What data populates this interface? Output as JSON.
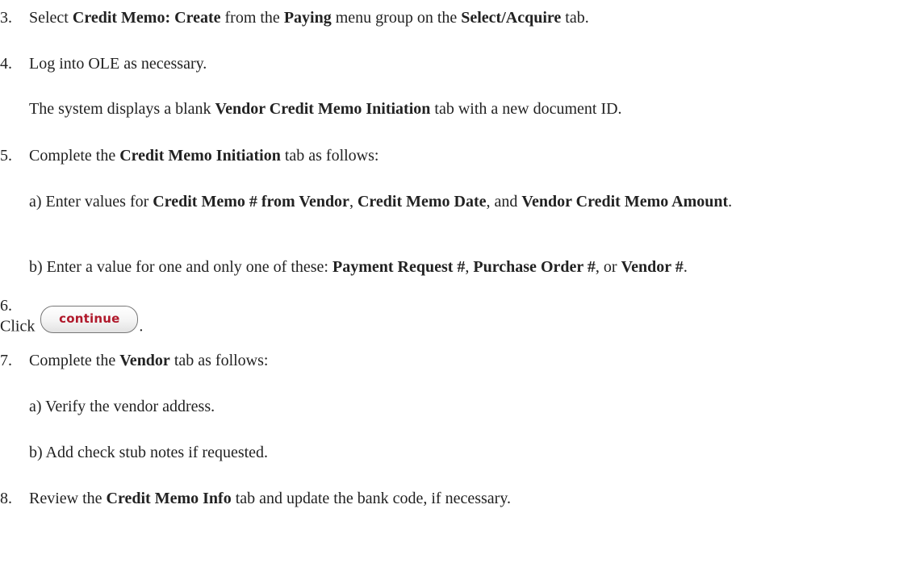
{
  "steps": [
    {
      "num": "3.",
      "parts": [
        "Select ",
        "Credit Memo: Create",
        " from the ",
        "Paying",
        " menu group on the ",
        "Select/Acquire",
        " tab."
      ]
    },
    {
      "num": "4.",
      "text": "Log into OLE as necessary.",
      "note_parts": [
        "The system displays a blank ",
        "Vendor Credit Memo Initiation",
        " tab with a new document ID."
      ]
    },
    {
      "num": "5.",
      "parts": [
        "Complete the ",
        "Credit Memo Initiation",
        " tab as follows:"
      ],
      "sub_a_parts": [
        "a) Enter values for ",
        "Credit Memo # from Vendor",
        ", ",
        "Credit Memo Date",
        ", and ",
        "Vendor Credit Memo Amount",
        "."
      ],
      "sub_b_parts": [
        "b) Enter a value for one and only one of these: ",
        "Payment Request #",
        ", ",
        "Purchase Order #",
        ", or ",
        "Vendor #",
        "."
      ]
    },
    {
      "num": "6.",
      "click_label": "Click",
      "button_label": "continue",
      "suffix": "."
    },
    {
      "num": "7.",
      "parts": [
        "Complete the ",
        "Vendor",
        " tab as follows:"
      ],
      "sub_a": "a) Verify the vendor address.",
      "sub_b": "b) Add check stub notes if requested."
    },
    {
      "num": "8.",
      "parts": [
        "Review the ",
        "Credit Memo Info",
        " tab and update the bank code, if necessary."
      ]
    }
  ]
}
